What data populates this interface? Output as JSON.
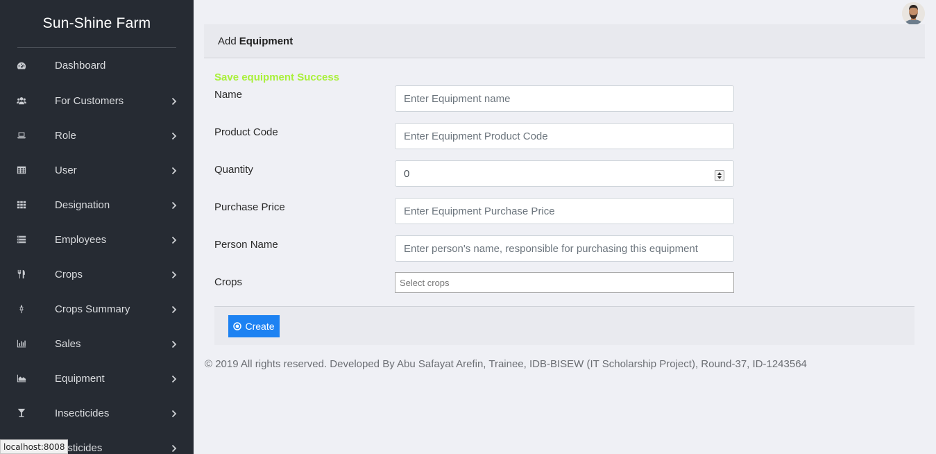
{
  "sidebar": {
    "brand": "Sun-Shine Farm",
    "items": [
      {
        "label": "Dashboard",
        "icon": "dashboard-icon",
        "has_submenu": false
      },
      {
        "label": "For Customers",
        "icon": "users-icon",
        "has_submenu": true
      },
      {
        "label": "Role",
        "icon": "laptop-icon",
        "has_submenu": true
      },
      {
        "label": "User",
        "icon": "table-icon",
        "has_submenu": true
      },
      {
        "label": "Designation",
        "icon": "grid-icon",
        "has_submenu": true
      },
      {
        "label": "Employees",
        "icon": "list-icon",
        "has_submenu": true
      },
      {
        "label": "Crops",
        "icon": "cutlery-icon",
        "has_submenu": true
      },
      {
        "label": "Crops Summary",
        "icon": "leaf-icon",
        "has_submenu": true
      },
      {
        "label": "Sales",
        "icon": "bar-chart-icon",
        "has_submenu": true
      },
      {
        "label": "Equipment",
        "icon": "area-chart-icon",
        "has_submenu": true
      },
      {
        "label": "Insecticides",
        "icon": "glass-icon",
        "has_submenu": true
      },
      {
        "label": "Pesticides",
        "icon": "bug-icon",
        "has_submenu": true
      }
    ]
  },
  "status_bar": {
    "url": "localhost:8008"
  },
  "card": {
    "header_prefix": "Add",
    "header_bold": "Equipment"
  },
  "form": {
    "success_message": "Save equipment Success",
    "name": {
      "label": "Name",
      "placeholder": "Enter Equipment name"
    },
    "product_code": {
      "label": "Product Code",
      "placeholder": "Enter Equipment Product Code"
    },
    "quantity": {
      "label": "Quantity",
      "value": "0"
    },
    "purchase_price": {
      "label": "Purchase Price",
      "placeholder": "Enter Equipment Purchase Price"
    },
    "person_name": {
      "label": "Person Name",
      "placeholder": "Enter person's name, responsible for purchasing this equipment"
    },
    "crops": {
      "label": "Crops",
      "placeholder": "Select crops"
    },
    "create_button": "Create"
  },
  "footer": {
    "text": "© 2019 All rights reserved. Developed By Abu Safayat Arefin, Trainee, IDB-BISEW (IT Scholarship Project), Round-37, ID-1243564"
  },
  "colors": {
    "sidebar_bg": "#262b33",
    "page_bg": "#eff0f5",
    "success": "#a9f03a",
    "primary_button": "#1d82f2"
  }
}
